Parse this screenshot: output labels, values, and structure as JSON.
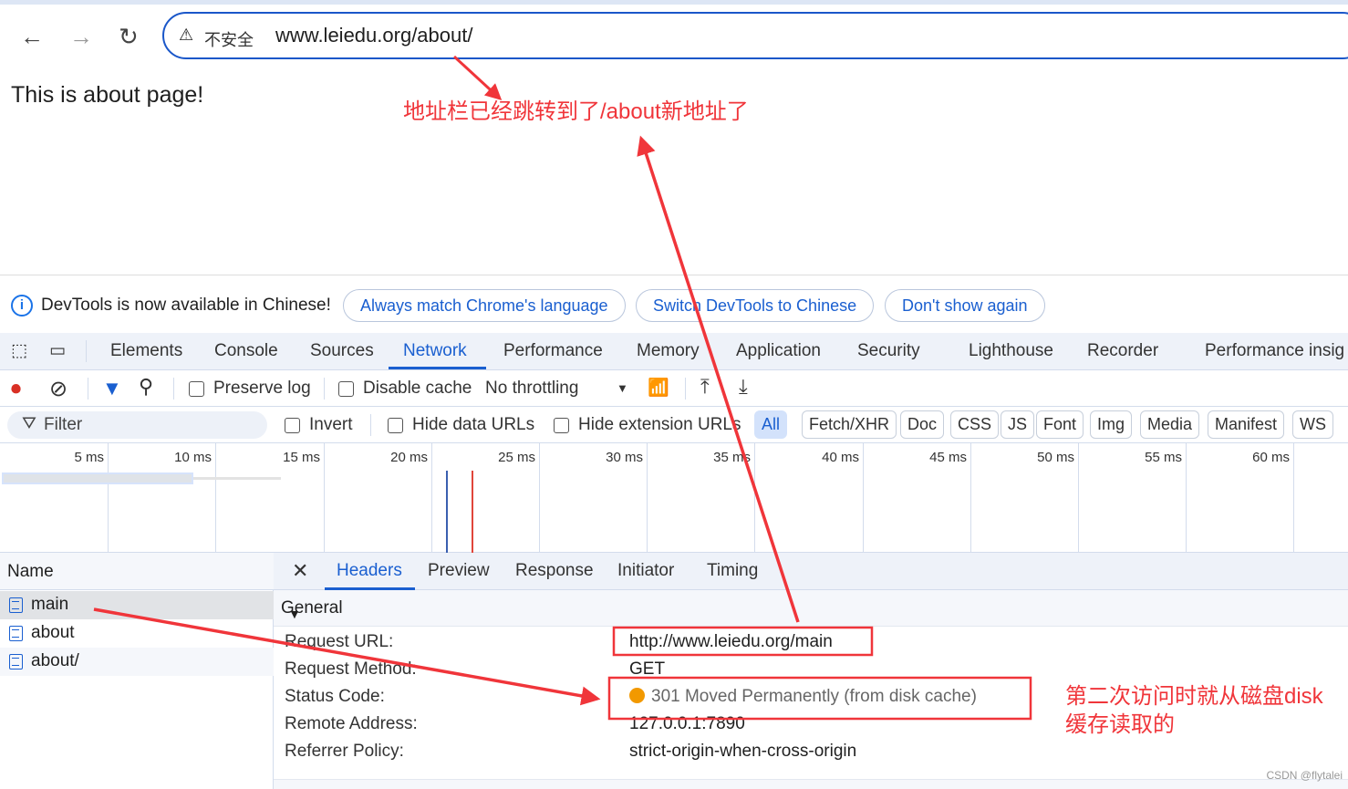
{
  "browser": {
    "insecure_label": "不安全",
    "url": "www.leiedu.org/about/"
  },
  "page": {
    "text": "This is about page!"
  },
  "infobar": {
    "message": "DevTools is now available in Chinese!",
    "buttons": [
      "Always match Chrome's language",
      "Switch DevTools to Chinese",
      "Don't show again"
    ]
  },
  "devtools": {
    "tabs": [
      "Elements",
      "Console",
      "Sources",
      "Network",
      "Performance",
      "Memory",
      "Application",
      "Security",
      "Lighthouse",
      "Recorder",
      "Performance insig"
    ],
    "active_tab": "Network",
    "toolbar": {
      "preserve_log": "Preserve log",
      "disable_cache": "Disable cache",
      "throttling": "No throttling"
    },
    "filter": {
      "placeholder": "Filter",
      "invert": "Invert",
      "hide_data_urls": "Hide data URLs",
      "hide_ext_urls": "Hide extension URLs",
      "types": [
        "All",
        "Fetch/XHR",
        "Doc",
        "CSS",
        "JS",
        "Font",
        "Img",
        "Media",
        "Manifest",
        "WS"
      ],
      "active_type": "All"
    },
    "timeline": {
      "ticks": [
        "5 ms",
        "10 ms",
        "15 ms",
        "20 ms",
        "25 ms",
        "30 ms",
        "35 ms",
        "40 ms",
        "45 ms",
        "50 ms",
        "55 ms",
        "60 ms"
      ]
    },
    "requests": {
      "header": "Name",
      "items": [
        "main",
        "about",
        "about/"
      ],
      "selected": "main"
    },
    "detail": {
      "tabs": [
        "Headers",
        "Preview",
        "Response",
        "Initiator",
        "Timing"
      ],
      "active": "Headers",
      "section": "General",
      "rows": [
        {
          "key": "Request URL:",
          "value": "http://www.leiedu.org/main"
        },
        {
          "key": "Request Method:",
          "value": "GET"
        },
        {
          "key": "Status Code:",
          "value": "301 Moved Permanently (from disk cache)"
        },
        {
          "key": "Remote Address:",
          "value": "127.0.0.1:7890"
        },
        {
          "key": "Referrer Policy:",
          "value": "strict-origin-when-cross-origin"
        }
      ]
    }
  },
  "annotations": {
    "address": "地址栏已经跳转到了/about新地址了",
    "cache": "第二次访问时就从磁盘disk缓存读取的",
    "color": "#f0353a"
  },
  "watermark": "CSDN @flytalei"
}
